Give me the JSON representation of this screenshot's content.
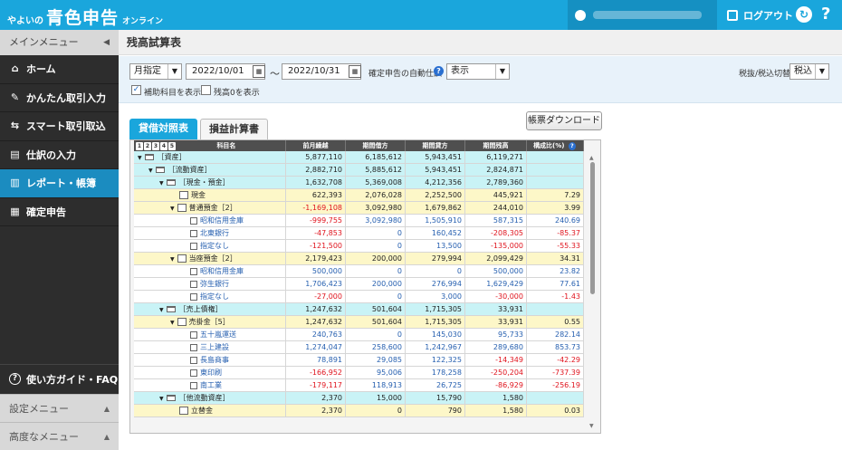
{
  "header": {
    "logo_small": "やよいの",
    "logo_main": "青色申告",
    "logo_sub": "オンライン",
    "logout_label": "ログアウト",
    "help_label": "?"
  },
  "sidebar": {
    "menu_title": "メインメニュー",
    "items": [
      {
        "label": "ホーム",
        "icon": "home-icon",
        "glyph": "⌂"
      },
      {
        "label": "かんたん取引入力",
        "icon": "pencil-icon",
        "glyph": "✎"
      },
      {
        "label": "スマート取引取込",
        "icon": "import-icon",
        "glyph": "⇆"
      },
      {
        "label": "仕訳の入力",
        "icon": "journal-icon",
        "glyph": "▤"
      },
      {
        "label": "レポート・帳簿",
        "icon": "chart-icon",
        "glyph": "▥"
      },
      {
        "label": "確定申告",
        "icon": "form-icon",
        "glyph": "▦"
      }
    ],
    "faq_label": "使い方ガイド・FAQ",
    "settings_menu": "設定メニュー",
    "advanced_menu": "高度なメニュー"
  },
  "page": {
    "title": "残高試算表"
  },
  "filter": {
    "period_type": "月指定",
    "date_from": "2022/10/01",
    "tilde": "〜",
    "date_to": "2022/10/31",
    "auto_journal_label": "確定申告の自動仕訳",
    "auto_journal_value": "表示",
    "tax_label": "税抜/税込切替",
    "tax_value": "税込",
    "sub_accounts_label": "補助科目を表示",
    "zero_balance_label": "残高0を表示"
  },
  "tabs": {
    "balance_sheet": "貸借対照表",
    "income_statement": "損益計算書"
  },
  "download_label": "帳票ダウンロード",
  "table": {
    "level_buttons": [
      "1",
      "2",
      "3",
      "4",
      "5"
    ],
    "headers": {
      "name": "科目名",
      "prev": "前月繰越",
      "debit": "期間借方",
      "credit": "期間貸方",
      "balance": "期間残高",
      "ratio": "構成比(%)"
    },
    "rows": [
      {
        "name": "［資産］",
        "prev": "5,877,110",
        "debit": "6,185,612",
        "credit": "5,943,451",
        "balance": "6,119,271",
        "ratio": ""
      },
      {
        "name": "［流動資産］",
        "prev": "2,882,710",
        "debit": "5,885,612",
        "credit": "5,943,451",
        "balance": "2,824,871",
        "ratio": ""
      },
      {
        "name": "［現金・預金］",
        "prev": "1,632,708",
        "debit": "5,369,008",
        "credit": "4,212,356",
        "balance": "2,789,360",
        "ratio": ""
      },
      {
        "name": "現金",
        "prev": "622,393",
        "debit": "2,076,028",
        "credit": "2,252,500",
        "balance": "445,921",
        "ratio": "7.29"
      },
      {
        "name": "普通預金［2］",
        "prev": "-1,169,108",
        "debit": "3,092,980",
        "credit": "1,679,862",
        "balance": "244,010",
        "ratio": "3.99"
      },
      {
        "name": "昭和信用金庫",
        "prev": "-999,755",
        "debit": "3,092,980",
        "credit": "1,505,910",
        "balance": "587,315",
        "ratio": "240.69"
      },
      {
        "name": "北東銀行",
        "prev": "-47,853",
        "debit": "0",
        "credit": "160,452",
        "balance": "-208,305",
        "ratio": "-85.37"
      },
      {
        "name": "指定なし",
        "prev": "-121,500",
        "debit": "0",
        "credit": "13,500",
        "balance": "-135,000",
        "ratio": "-55.33"
      },
      {
        "name": "当座預金［2］",
        "prev": "2,179,423",
        "debit": "200,000",
        "credit": "279,994",
        "balance": "2,099,429",
        "ratio": "34.31"
      },
      {
        "name": "昭和信用金庫",
        "prev": "500,000",
        "debit": "0",
        "credit": "0",
        "balance": "500,000",
        "ratio": "23.82"
      },
      {
        "name": "弥生銀行",
        "prev": "1,706,423",
        "debit": "200,000",
        "credit": "276,994",
        "balance": "1,629,429",
        "ratio": "77.61"
      },
      {
        "name": "指定なし",
        "prev": "-27,000",
        "debit": "0",
        "credit": "3,000",
        "balance": "-30,000",
        "ratio": "-1.43"
      },
      {
        "name": "［売上債権］",
        "prev": "1,247,632",
        "debit": "501,604",
        "credit": "1,715,305",
        "balance": "33,931",
        "ratio": ""
      },
      {
        "name": "売掛金［5］",
        "prev": "1,247,632",
        "debit": "501,604",
        "credit": "1,715,305",
        "balance": "33,931",
        "ratio": "0.55"
      },
      {
        "name": "五十嵐運送",
        "prev": "240,763",
        "debit": "0",
        "credit": "145,030",
        "balance": "95,733",
        "ratio": "282.14"
      },
      {
        "name": "三上建設",
        "prev": "1,274,047",
        "debit": "258,600",
        "credit": "1,242,967",
        "balance": "289,680",
        "ratio": "853.73"
      },
      {
        "name": "長島商事",
        "prev": "78,891",
        "debit": "29,085",
        "credit": "122,325",
        "balance": "-14,349",
        "ratio": "-42.29"
      },
      {
        "name": "東印刷",
        "prev": "-166,952",
        "debit": "95,006",
        "credit": "178,258",
        "balance": "-250,204",
        "ratio": "-737.39"
      },
      {
        "name": "南工業",
        "prev": "-179,117",
        "debit": "118,913",
        "credit": "26,725",
        "balance": "-86,929",
        "ratio": "-256.19"
      },
      {
        "name": "［他流動資産］",
        "prev": "2,370",
        "debit": "15,000",
        "credit": "15,790",
        "balance": "1,580",
        "ratio": ""
      },
      {
        "name": "立替金",
        "prev": "2,370",
        "debit": "0",
        "credit": "790",
        "balance": "1,580",
        "ratio": "0.03"
      }
    ]
  }
}
